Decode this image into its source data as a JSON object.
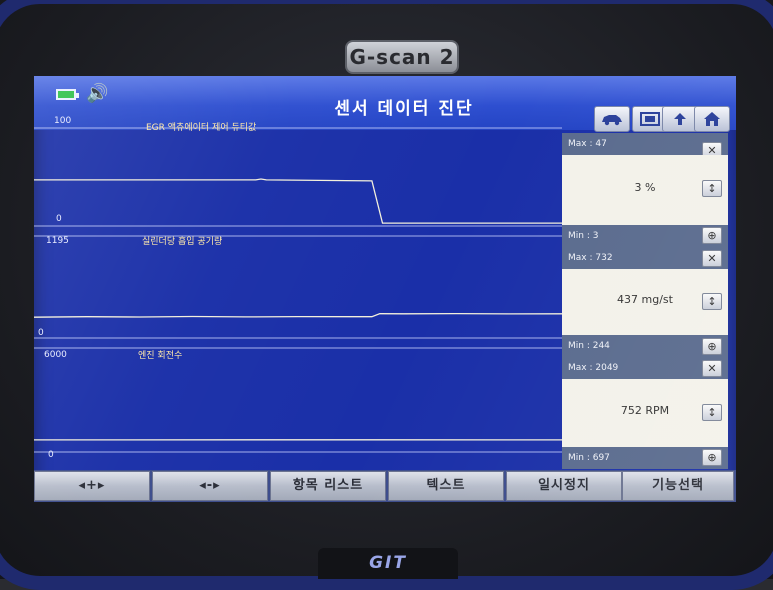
{
  "device": {
    "brand": "G-scan 2",
    "footer_brand": "GIT"
  },
  "header": {
    "title": "센서 데이터 진단",
    "icons": [
      "battery-icon",
      "speaker-icon",
      "vehicle-icon",
      "record-icon",
      "back-icon",
      "home-icon"
    ]
  },
  "sensors": [
    {
      "label": "EGR 액츄에이터 제어 듀티값",
      "axis_max": "100",
      "axis_min": "0",
      "max": "Max : 47",
      "value": "3 %",
      "min": "Min : 3",
      "trace": [
        [
          0,
          47
        ],
        [
          0.42,
          47
        ],
        [
          0.43,
          48
        ],
        [
          0.44,
          47
        ],
        [
          0.64,
          46
        ],
        [
          0.66,
          3
        ],
        [
          1.0,
          3
        ]
      ]
    },
    {
      "label": "실린더당 흡입 공기량",
      "axis_max": "1195",
      "axis_min": "0",
      "max": "Max : 732",
      "value": "437 mg/st",
      "min": "Min : 244",
      "trace": [
        [
          0,
          244
        ],
        [
          0.1,
          250
        ],
        [
          0.2,
          246
        ],
        [
          0.3,
          252
        ],
        [
          0.4,
          247
        ],
        [
          0.5,
          251
        ],
        [
          0.6,
          249
        ],
        [
          0.64,
          250
        ],
        [
          0.655,
          285
        ],
        [
          0.7,
          283
        ],
        [
          0.8,
          286
        ],
        [
          0.9,
          282
        ],
        [
          1.0,
          284
        ]
      ]
    },
    {
      "label": "엔진 회전수",
      "axis_max": "6000",
      "axis_min": "0",
      "max": "Max : 2049",
      "value": "752 RPM",
      "min": "Min : 697",
      "trace": [
        [
          0,
          700
        ],
        [
          0.5,
          705
        ],
        [
          1.0,
          698
        ]
      ]
    }
  ],
  "buttons": {
    "zoom_in": "◂+▸",
    "zoom_out": "◂-▸",
    "item_list": "항목 리스트",
    "text": "텍스트",
    "pause": "일시정지",
    "function_select": "기능선택"
  }
}
